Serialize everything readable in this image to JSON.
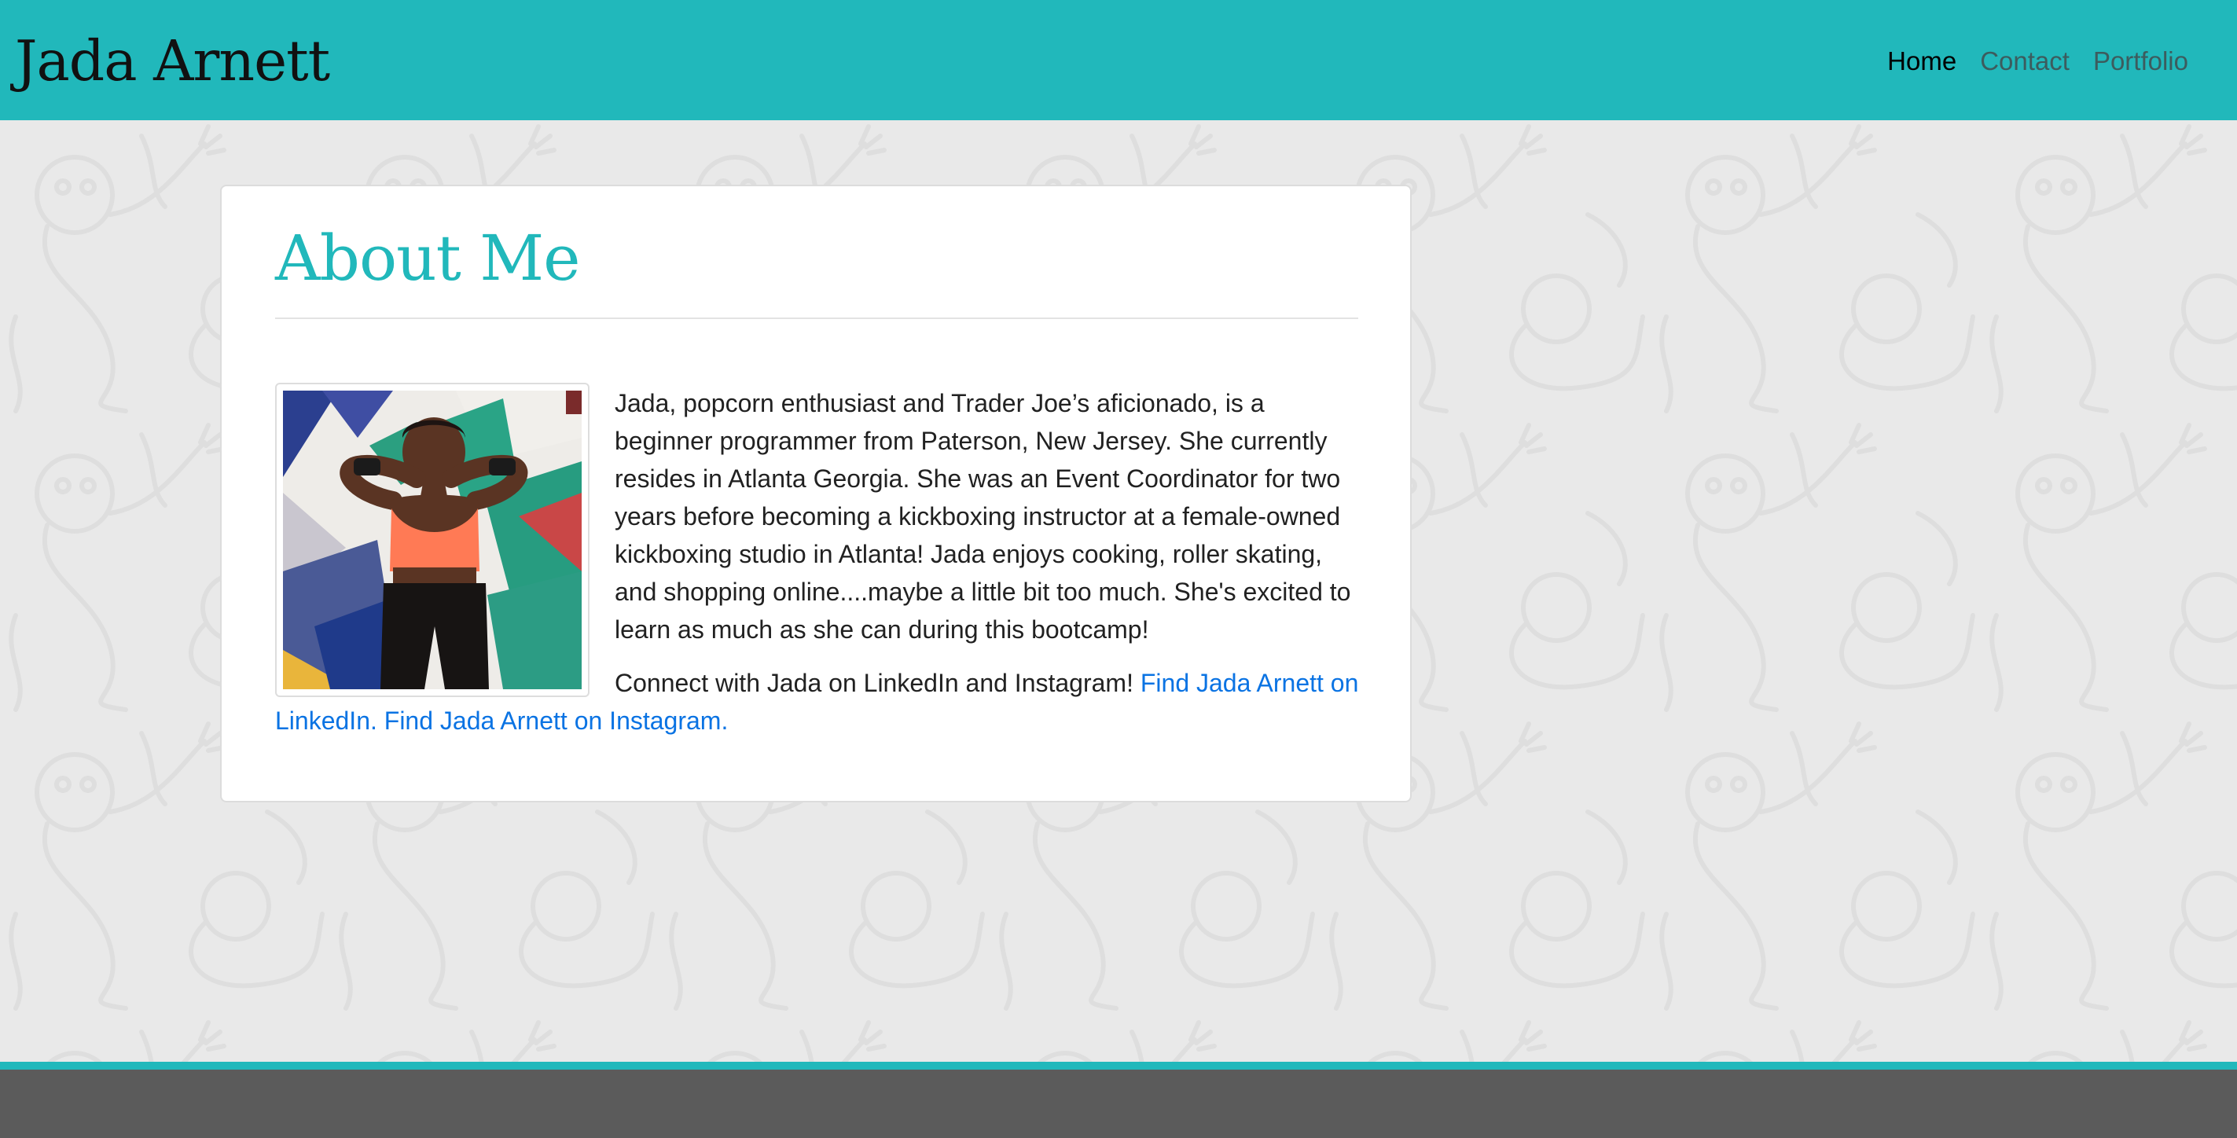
{
  "header": {
    "brand": "Jada Arnett",
    "nav": [
      {
        "label": "Home",
        "active": true
      },
      {
        "label": "Contact",
        "active": false
      },
      {
        "label": "Portfolio",
        "active": false
      }
    ]
  },
  "main": {
    "title": "About Me",
    "bio": "Jada, popcorn enthusiast and Trader Joe’s aficionado, is a beginner programmer from Paterson, New Jersey. She currently resides in Atlanta Georgia. She was an Event Coordinator for two years before becoming a kickboxing instructor at a female-owned kickboxing studio in Atlanta! Jada enjoys cooking, roller skating, and shopping online....maybe a little bit too much. She's excited to learn as much as she can during this bootcamp!",
    "connect_text": "Connect with Jada on LinkedIn and Instagram!",
    "linkedin_link": "Find Jada Arnett on LinkedIn.",
    "instagram_link": "Find Jada Arnett on Instagram."
  },
  "colors": {
    "accent": "#21b8bb",
    "link": "#0a73e3",
    "footer": "#5b5b5b",
    "background": "#e9e9e9"
  },
  "icons": {
    "profile_photo": "profile-photo"
  }
}
